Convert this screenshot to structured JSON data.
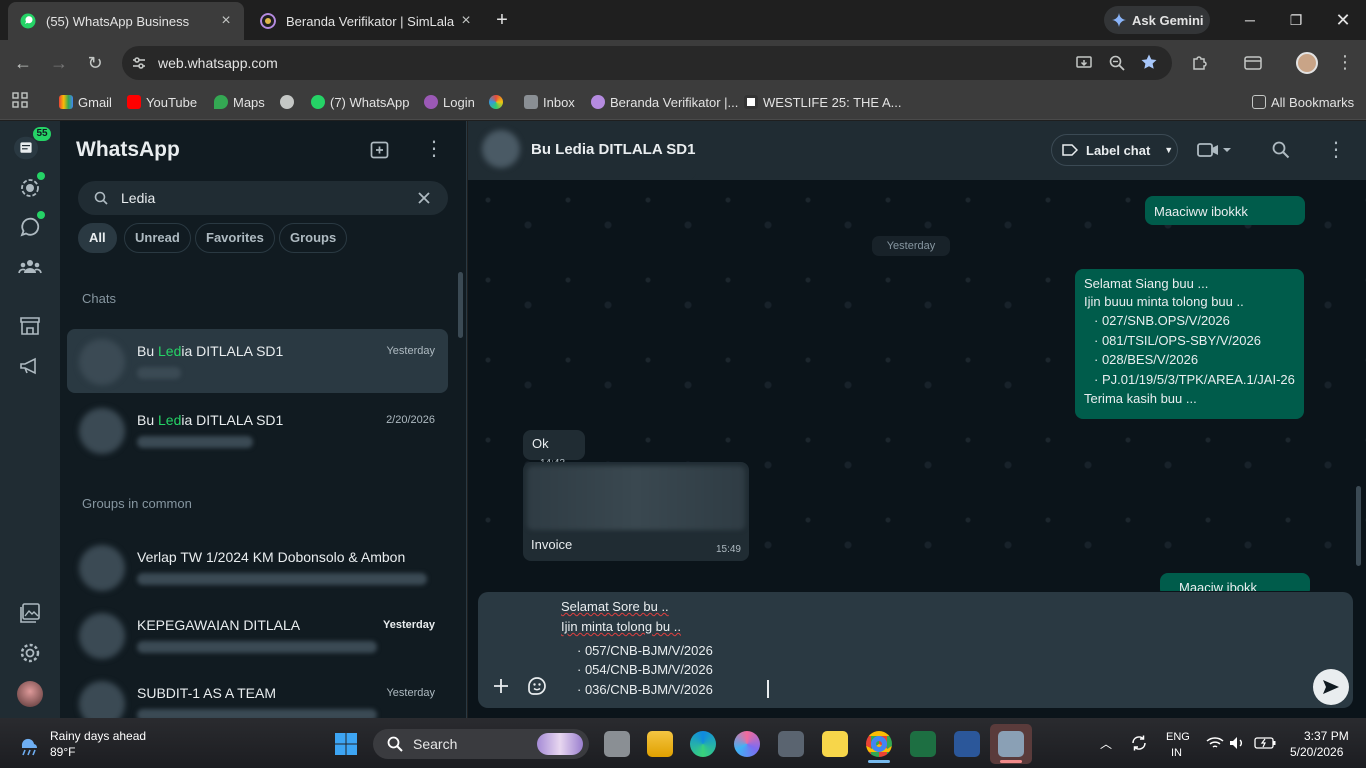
{
  "browser": {
    "tabs": [
      {
        "title": "(55) WhatsApp Business",
        "active": true
      },
      {
        "title": "Beranda Verifikator | SimLala",
        "active": false
      }
    ],
    "new_tab_label": "+",
    "gemini_label": "Ask Gemini",
    "url": "web.whatsapp.com",
    "bookmarks": [
      "Gmail",
      "YouTube",
      "Maps",
      "(7) WhatsApp",
      "Login",
      "Inbox",
      "Beranda Verifikator |...",
      "WESTLIFE 25: THE A..."
    ],
    "all_bookmarks_label": "All Bookmarks",
    "accent": "#e3e3e3"
  },
  "rail": {
    "unread_badge": "55"
  },
  "sidebar": {
    "title": "WhatsApp",
    "search": {
      "value": "Ledia"
    },
    "filters": [
      "All",
      "Unread",
      "Favorites",
      "Groups"
    ],
    "chats_section": "Chats",
    "chats": [
      {
        "name_before": "Bu ",
        "name_match": "Led",
        "name_after": "ia DITLALA SD1",
        "time": "Yesterday"
      },
      {
        "name_before": "Bu ",
        "name_match": "Led",
        "name_after": "ia DITLALA SD1",
        "time": "2/20/2026"
      }
    ],
    "groups_section": "Groups in common",
    "groups": [
      {
        "name": "Verlap TW 1/2024 KM Dobonsolo & Ambon",
        "time": ""
      },
      {
        "name": "KEPEGAWAIAN DITLALA",
        "time": "Yesterday"
      },
      {
        "name": "SUBDIT-1 AS A TEAM",
        "time": "Yesterday"
      }
    ]
  },
  "chat": {
    "contact_name": "Bu Ledia DITLALA SD1",
    "label_button": "Label chat",
    "day_divider": "Yesterday",
    "messages": {
      "m1": {
        "text": "Maaciww ibokkk"
      },
      "m2": {
        "line1": "Selamat Siang buu ...",
        "line2": "Ijin buuu minta tolong buu ..",
        "items": [
          "027/SNB.OPS/V/2026",
          "081/TSIL/OPS-SBY/V/2026",
          "028/BES/V/2026",
          "PJ.01/19/5/3/TPK/AREA.1/JAI-26"
        ],
        "closing": "Terima kasih buu ..."
      },
      "m3": {
        "text": "Ok",
        "time": "14:43"
      },
      "m4": {
        "caption": "Invoice",
        "time": "15:49"
      },
      "m5": {
        "text": "Maaciw ibokk"
      }
    },
    "composer": {
      "line1": "Selamat Sore bu ..",
      "line2": "Ijin minta tolong bu ..",
      "items": [
        "057/CNB-BJM/V/2026",
        "054/CNB-BJM/V/2026",
        "036/CNB-BJM/V/2026"
      ]
    },
    "colors": {
      "outgoing": "#005c4b",
      "incoming": "#202c33",
      "accent": "#25d366"
    }
  },
  "taskbar": {
    "weather_title": "Rainy days ahead",
    "weather_temp": "89°F",
    "search_placeholder": "Search",
    "lang": "ENG",
    "region": "IN",
    "time": "3:37 PM",
    "date": "5/20/2026"
  }
}
